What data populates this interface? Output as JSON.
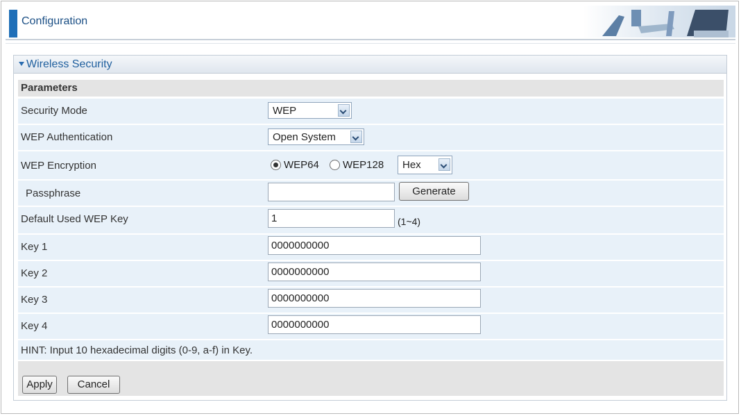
{
  "header": {
    "title": "Configuration"
  },
  "panel": {
    "title": "Wireless Security"
  },
  "section": {
    "title": "Parameters"
  },
  "fields": {
    "security_mode": {
      "label": "Security Mode",
      "value": "WEP"
    },
    "wep_auth": {
      "label": "WEP Authentication",
      "value": "Open System"
    },
    "wep_encryption": {
      "label": "WEP Encryption",
      "option_64": "WEP64",
      "option_128": "WEP128",
      "selected": "WEP64",
      "format_value": "Hex"
    },
    "passphrase": {
      "label": "Passphrase",
      "value": "",
      "generate_label": "Generate"
    },
    "default_key": {
      "label": "Default Used WEP Key",
      "value": "1",
      "range": "(1~4)"
    },
    "keys": [
      {
        "label": "Key 1",
        "value": "0000000000"
      },
      {
        "label": "Key 2",
        "value": "0000000000"
      },
      {
        "label": "Key 3",
        "value": "0000000000"
      },
      {
        "label": "Key 4",
        "value": "0000000000"
      }
    ]
  },
  "hint": "HINT: Input 10 hexadecimal digits (0-9, a-f) in Key.",
  "actions": {
    "apply": "Apply",
    "cancel": "Cancel"
  },
  "colors": {
    "accent": "#1f6fb8",
    "title_text": "#1f5f9e",
    "row_bg": "#e8f1f9",
    "section_bg": "#e4e4e4"
  }
}
